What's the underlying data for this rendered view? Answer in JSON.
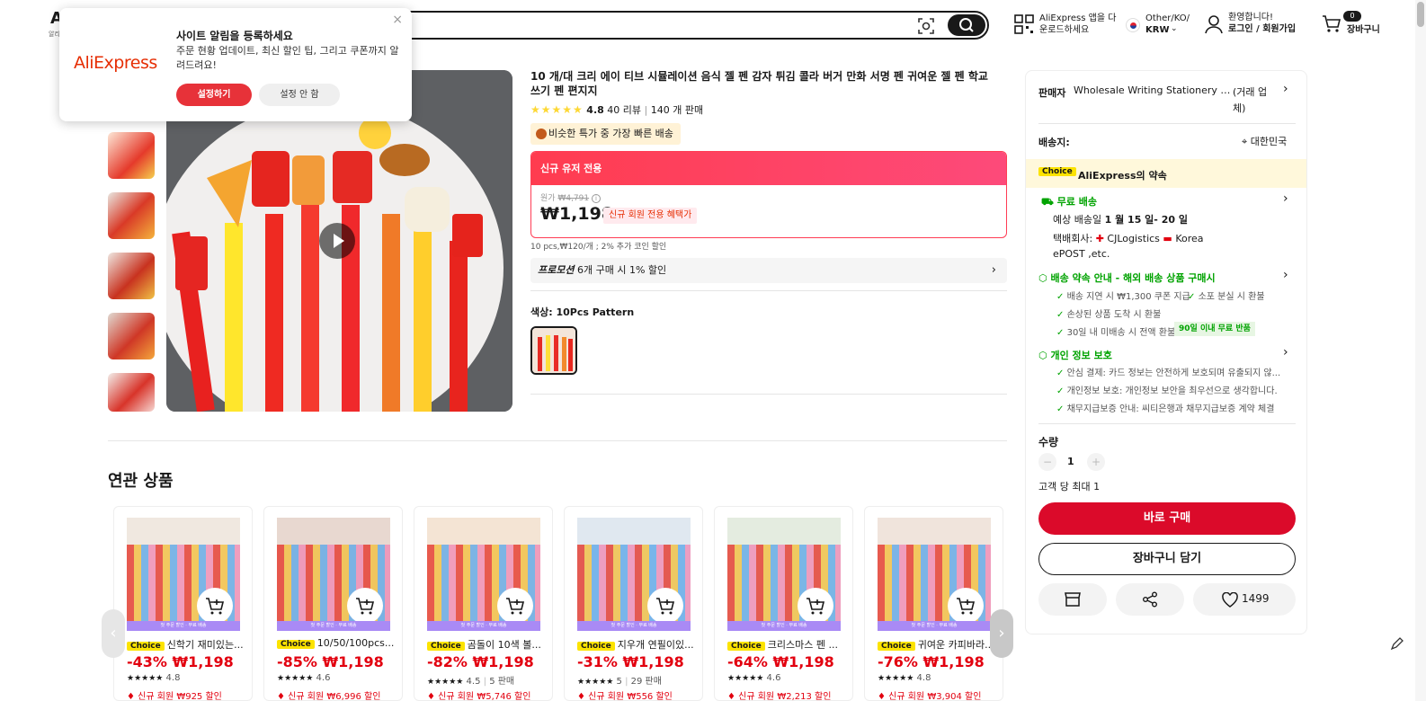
{
  "header": {
    "logo": "A",
    "logo_sub": "알리",
    "search_placeholder": "",
    "app_download": [
      "AliExpress 앱을 다",
      "운로드하세요"
    ],
    "locale": [
      "Other/KO/",
      "KRW"
    ],
    "account": [
      "환영합니다!",
      "로그인 / 회원가입"
    ],
    "cart_count": "0",
    "cart_label": "장바구니"
  },
  "popup": {
    "brand": "AliExpress",
    "title": "사이트 알림을 등록하세요",
    "desc": "주문 현황 업데이트, 최신 할인 팁, 그리고 쿠폰까지 알려드려요!",
    "allow": "설정하기",
    "deny": "설정 안 함",
    "close": "×"
  },
  "product": {
    "title": "10 개/대 크리 에이 티브 시뮬레이션 음식 젤 펜 감자 튀김 콜라 버거 만화 서명 펜 귀여운 젤 펜 학교 쓰기 펜 편지지",
    "rating": "4.8",
    "reviews": "40 리뷰",
    "sold": "140 개 판매",
    "fast_ship": "비슷한 특가 중 가장 빠른 배송",
    "deal_header": "신규 유저 전용",
    "orig_label": "원가",
    "orig_price": "₩4,791",
    "price": "₩1,198",
    "new_member_tag": "신규 회원 전용 혜택가",
    "subline": "10 pcs,₩120/개 ; 2% 추가 코인 할인",
    "promo_label": "프로모션",
    "promo_text": "6개 구매 시 1% 할인",
    "color_label": "색상: 10Pcs Pattern",
    "related_title": "연관 상품"
  },
  "panel": {
    "seller_label": "판매자",
    "seller_name": "Wholesale Writing Stationery Sto...",
    "seller_extra": "(거래 업체)",
    "ship_to_label": "배송지:",
    "ship_to": "대한민국",
    "choice": "Choice",
    "promise": "AliExpress의 약속",
    "free_ship": "무료 배송",
    "eta_prefix": "예상 배송일",
    "eta": "1 월 15 일- 20 일",
    "carrier_label": "택배회사:",
    "carrier1": "CJLogistics",
    "carrier2": "Korea",
    "carrier3": "ePOST ,etc.",
    "guarantee": "배송 약속 안내 - 해외 배송 상품 구매시",
    "g1": "배송 지연 시 ₩1,300 쿠폰 지급",
    "g2": "소포 분실 시 환불",
    "g3": "손상된 상품 도착 시 환불",
    "g4": "30일 내 미배송 시 전액 환불",
    "g4_tag": "90일 이내 무료 반품",
    "privacy": "개인 정보 보호",
    "p1": "안심 결제: 카드 정보는 안전하게 보호되며 유출되지 않...",
    "p2": "개인정보 보호: 개인정보 보안을 최우선으로 생각합니다.",
    "p3": "채무지급보증 안내: 씨티은행과 채무지급보증 계약 체결",
    "qty_label": "수량",
    "qty_minus": "−",
    "qty": "1",
    "qty_plus": "+",
    "max": "고객 당 최대 1",
    "buy": "바로 구매",
    "add_cart": "장바구니 담기",
    "wishlist": "1499"
  },
  "related": [
    {
      "name": "신학기 재미있는...",
      "price": "-43% ₩1,198",
      "rating": "4.8",
      "sold": "",
      "coupon": "신규 회원 ₩925 할인",
      "img": "#f0e8e0"
    },
    {
      "name": "10/50/100pcs...",
      "price": "-85% ₩1,198",
      "rating": "4.6",
      "sold": "",
      "coupon": "신규 회원 ₩6,996 할인",
      "img": "#e8d8d0"
    },
    {
      "name": "곰돌이 10색 볼...",
      "price": "-82% ₩1,198",
      "rating": "4.5",
      "sold": "5 판매",
      "coupon": "신규 회원 ₩5,746 할인",
      "img": "#f4e4d4"
    },
    {
      "name": "지우개 연필이있...",
      "price": "-31% ₩1,198",
      "rating": "5",
      "sold": "29 판매",
      "coupon": "신규 회원 ₩556 할인",
      "img": "#e0e8f0"
    },
    {
      "name": "크리스마스 펜 ...",
      "price": "-64% ₩1,198",
      "rating": "4.6",
      "sold": "",
      "coupon": "신규 회원 ₩2,213 할인",
      "img": "#e4ece0"
    },
    {
      "name": "귀여운 카피바라...",
      "price": "-76% ₩1,198",
      "rating": "4.8",
      "sold": "",
      "coupon": "신규 회원 ₩3,904 할인",
      "img": "#f0e4dc"
    }
  ],
  "related_strip": "첫 주문 할인 · 무료 배송",
  "related_choice": "Choice",
  "colors": {
    "accent": "#db0a2a",
    "choice": "#fce300",
    "green": "#00a300"
  }
}
